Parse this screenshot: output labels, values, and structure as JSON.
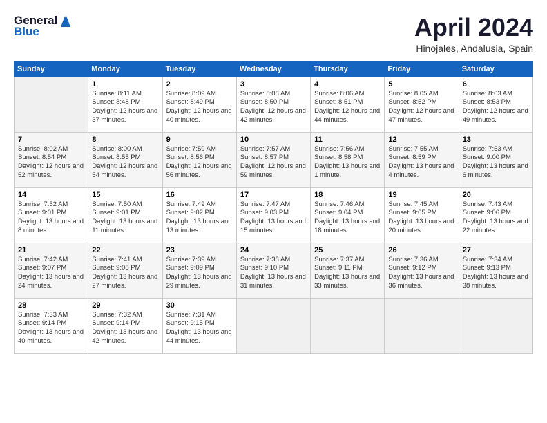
{
  "logo": {
    "text_general": "General",
    "text_blue": "Blue"
  },
  "title": {
    "month": "April 2024",
    "location": "Hinojales, Andalusia, Spain"
  },
  "weekdays": [
    "Sunday",
    "Monday",
    "Tuesday",
    "Wednesday",
    "Thursday",
    "Friday",
    "Saturday"
  ],
  "weeks": [
    [
      {
        "day": "",
        "sunrise": "",
        "sunset": "",
        "daylight": ""
      },
      {
        "day": "1",
        "sunrise": "Sunrise: 8:11 AM",
        "sunset": "Sunset: 8:48 PM",
        "daylight": "Daylight: 12 hours and 37 minutes."
      },
      {
        "day": "2",
        "sunrise": "Sunrise: 8:09 AM",
        "sunset": "Sunset: 8:49 PM",
        "daylight": "Daylight: 12 hours and 40 minutes."
      },
      {
        "day": "3",
        "sunrise": "Sunrise: 8:08 AM",
        "sunset": "Sunset: 8:50 PM",
        "daylight": "Daylight: 12 hours and 42 minutes."
      },
      {
        "day": "4",
        "sunrise": "Sunrise: 8:06 AM",
        "sunset": "Sunset: 8:51 PM",
        "daylight": "Daylight: 12 hours and 44 minutes."
      },
      {
        "day": "5",
        "sunrise": "Sunrise: 8:05 AM",
        "sunset": "Sunset: 8:52 PM",
        "daylight": "Daylight: 12 hours and 47 minutes."
      },
      {
        "day": "6",
        "sunrise": "Sunrise: 8:03 AM",
        "sunset": "Sunset: 8:53 PM",
        "daylight": "Daylight: 12 hours and 49 minutes."
      }
    ],
    [
      {
        "day": "7",
        "sunrise": "Sunrise: 8:02 AM",
        "sunset": "Sunset: 8:54 PM",
        "daylight": "Daylight: 12 hours and 52 minutes."
      },
      {
        "day": "8",
        "sunrise": "Sunrise: 8:00 AM",
        "sunset": "Sunset: 8:55 PM",
        "daylight": "Daylight: 12 hours and 54 minutes."
      },
      {
        "day": "9",
        "sunrise": "Sunrise: 7:59 AM",
        "sunset": "Sunset: 8:56 PM",
        "daylight": "Daylight: 12 hours and 56 minutes."
      },
      {
        "day": "10",
        "sunrise": "Sunrise: 7:57 AM",
        "sunset": "Sunset: 8:57 PM",
        "daylight": "Daylight: 12 hours and 59 minutes."
      },
      {
        "day": "11",
        "sunrise": "Sunrise: 7:56 AM",
        "sunset": "Sunset: 8:58 PM",
        "daylight": "Daylight: 13 hours and 1 minute."
      },
      {
        "day": "12",
        "sunrise": "Sunrise: 7:55 AM",
        "sunset": "Sunset: 8:59 PM",
        "daylight": "Daylight: 13 hours and 4 minutes."
      },
      {
        "day": "13",
        "sunrise": "Sunrise: 7:53 AM",
        "sunset": "Sunset: 9:00 PM",
        "daylight": "Daylight: 13 hours and 6 minutes."
      }
    ],
    [
      {
        "day": "14",
        "sunrise": "Sunrise: 7:52 AM",
        "sunset": "Sunset: 9:01 PM",
        "daylight": "Daylight: 13 hours and 8 minutes."
      },
      {
        "day": "15",
        "sunrise": "Sunrise: 7:50 AM",
        "sunset": "Sunset: 9:01 PM",
        "daylight": "Daylight: 13 hours and 11 minutes."
      },
      {
        "day": "16",
        "sunrise": "Sunrise: 7:49 AM",
        "sunset": "Sunset: 9:02 PM",
        "daylight": "Daylight: 13 hours and 13 minutes."
      },
      {
        "day": "17",
        "sunrise": "Sunrise: 7:47 AM",
        "sunset": "Sunset: 9:03 PM",
        "daylight": "Daylight: 13 hours and 15 minutes."
      },
      {
        "day": "18",
        "sunrise": "Sunrise: 7:46 AM",
        "sunset": "Sunset: 9:04 PM",
        "daylight": "Daylight: 13 hours and 18 minutes."
      },
      {
        "day": "19",
        "sunrise": "Sunrise: 7:45 AM",
        "sunset": "Sunset: 9:05 PM",
        "daylight": "Daylight: 13 hours and 20 minutes."
      },
      {
        "day": "20",
        "sunrise": "Sunrise: 7:43 AM",
        "sunset": "Sunset: 9:06 PM",
        "daylight": "Daylight: 13 hours and 22 minutes."
      }
    ],
    [
      {
        "day": "21",
        "sunrise": "Sunrise: 7:42 AM",
        "sunset": "Sunset: 9:07 PM",
        "daylight": "Daylight: 13 hours and 24 minutes."
      },
      {
        "day": "22",
        "sunrise": "Sunrise: 7:41 AM",
        "sunset": "Sunset: 9:08 PM",
        "daylight": "Daylight: 13 hours and 27 minutes."
      },
      {
        "day": "23",
        "sunrise": "Sunrise: 7:39 AM",
        "sunset": "Sunset: 9:09 PM",
        "daylight": "Daylight: 13 hours and 29 minutes."
      },
      {
        "day": "24",
        "sunrise": "Sunrise: 7:38 AM",
        "sunset": "Sunset: 9:10 PM",
        "daylight": "Daylight: 13 hours and 31 minutes."
      },
      {
        "day": "25",
        "sunrise": "Sunrise: 7:37 AM",
        "sunset": "Sunset: 9:11 PM",
        "daylight": "Daylight: 13 hours and 33 minutes."
      },
      {
        "day": "26",
        "sunrise": "Sunrise: 7:36 AM",
        "sunset": "Sunset: 9:12 PM",
        "daylight": "Daylight: 13 hours and 36 minutes."
      },
      {
        "day": "27",
        "sunrise": "Sunrise: 7:34 AM",
        "sunset": "Sunset: 9:13 PM",
        "daylight": "Daylight: 13 hours and 38 minutes."
      }
    ],
    [
      {
        "day": "28",
        "sunrise": "Sunrise: 7:33 AM",
        "sunset": "Sunset: 9:14 PM",
        "daylight": "Daylight: 13 hours and 40 minutes."
      },
      {
        "day": "29",
        "sunrise": "Sunrise: 7:32 AM",
        "sunset": "Sunset: 9:14 PM",
        "daylight": "Daylight: 13 hours and 42 minutes."
      },
      {
        "day": "30",
        "sunrise": "Sunrise: 7:31 AM",
        "sunset": "Sunset: 9:15 PM",
        "daylight": "Daylight: 13 hours and 44 minutes."
      },
      {
        "day": "",
        "sunrise": "",
        "sunset": "",
        "daylight": ""
      },
      {
        "day": "",
        "sunrise": "",
        "sunset": "",
        "daylight": ""
      },
      {
        "day": "",
        "sunrise": "",
        "sunset": "",
        "daylight": ""
      },
      {
        "day": "",
        "sunrise": "",
        "sunset": "",
        "daylight": ""
      }
    ]
  ]
}
